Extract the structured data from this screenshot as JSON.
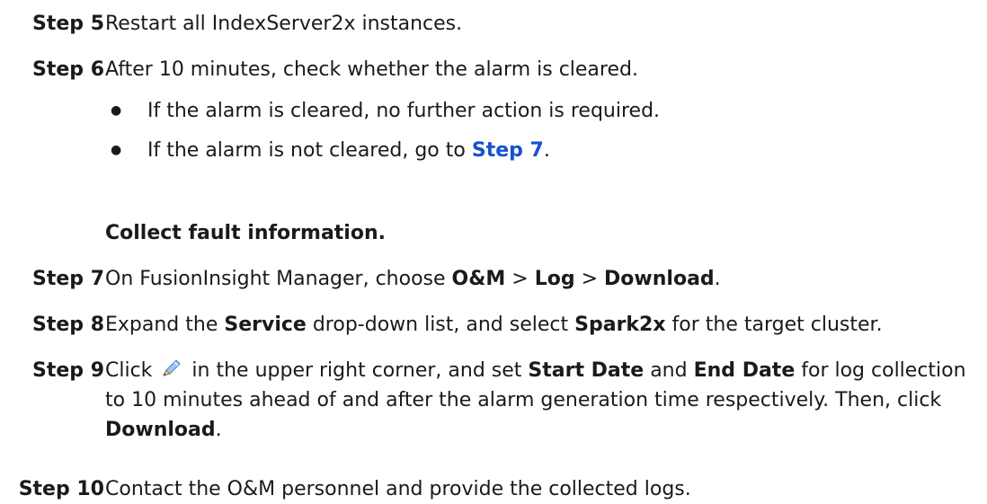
{
  "steps": {
    "s5": {
      "label": "Step 5",
      "text": "Restart all IndexServer2x instances."
    },
    "s6": {
      "label": "Step 6",
      "text": "After 10 minutes, check whether the alarm is cleared.",
      "bullets": [
        {
          "text": "If the alarm is cleared, no further action is required."
        },
        {
          "text_before": "If the alarm is not cleared, go to ",
          "link": "Step 7",
          "text_after": "."
        }
      ]
    },
    "section_heading": "Collect fault information.",
    "s7": {
      "label": "Step 7",
      "t1": "On FusionInsight Manager, choose ",
      "b1": "O&M",
      "t2": " > ",
      "b2": "Log",
      "t3": " > ",
      "b3": "Download",
      "t4": "."
    },
    "s8": {
      "label": "Step 8",
      "t1": "Expand the ",
      "b1": "Service",
      "t2": " drop-down list, and select ",
      "b2": "Spark2x",
      "t3": " for the target cluster."
    },
    "s9": {
      "label": "Step 9",
      "t1": "Click",
      "icon": "pencil-icon",
      "t2": "in the upper right corner, and set ",
      "b1": "Start Date",
      "t3": " and ",
      "b2": "End Date",
      "t4": " for log collection to 10 minutes ahead of and after the alarm generation time respectively. Then, click ",
      "b3": "Download",
      "t5": "."
    },
    "s10": {
      "label": "Step 10",
      "text": "Contact the O&M personnel and provide the collected logs."
    }
  },
  "colors": {
    "link": "#1652d0",
    "text": "#1a1a1a"
  },
  "bullet_symbol": "●"
}
